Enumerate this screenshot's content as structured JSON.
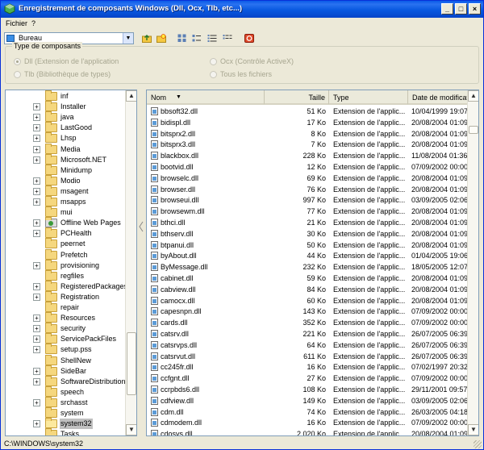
{
  "window": {
    "title": "Enregistrement de composants Windows (Dll, Ocx, Tlb, etc...)",
    "minimize": "_",
    "maximize": "□",
    "close": "×"
  },
  "menu": {
    "items": [
      "Fichier",
      "?"
    ]
  },
  "toolbar": {
    "location": "Bureau",
    "dropdown_glyph": "▼"
  },
  "component_type": {
    "legend": "Type de composants",
    "options": [
      {
        "label": "Dll (Extension de l'application",
        "checked": true
      },
      {
        "label": "Tlb (Bibliothèque de types)",
        "checked": false
      },
      {
        "label": "Ocx (Contrôle ActiveX)",
        "checked": false
      },
      {
        "label": "Tous les fichiers",
        "checked": false
      }
    ]
  },
  "tree": {
    "folders": [
      {
        "label": "inf",
        "expander": ""
      },
      {
        "label": "Installer",
        "expander": "+"
      },
      {
        "label": "java",
        "expander": "+"
      },
      {
        "label": "LastGood",
        "expander": "+"
      },
      {
        "label": "Lhsp",
        "expander": "+"
      },
      {
        "label": "Media",
        "expander": "+"
      },
      {
        "label": "Microsoft.NET",
        "expander": "+"
      },
      {
        "label": "Minidump",
        "expander": ""
      },
      {
        "label": "Modio",
        "expander": "+"
      },
      {
        "label": "msagent",
        "expander": "+"
      },
      {
        "label": "msapps",
        "expander": "+"
      },
      {
        "label": "mui",
        "expander": ""
      },
      {
        "label": "Offline Web Pages",
        "expander": "+",
        "special": true
      },
      {
        "label": "PCHealth",
        "expander": "+"
      },
      {
        "label": "peernet",
        "expander": ""
      },
      {
        "label": "Prefetch",
        "expander": ""
      },
      {
        "label": "provisioning",
        "expander": "+"
      },
      {
        "label": "regfiles",
        "expander": ""
      },
      {
        "label": "RegisteredPackages",
        "expander": "+"
      },
      {
        "label": "Registration",
        "expander": "+"
      },
      {
        "label": "repair",
        "expander": ""
      },
      {
        "label": "Resources",
        "expander": "+"
      },
      {
        "label": "security",
        "expander": "+"
      },
      {
        "label": "ServicePackFiles",
        "expander": "+"
      },
      {
        "label": "setup.pss",
        "expander": "+"
      },
      {
        "label": "ShellNew",
        "expander": ""
      },
      {
        "label": "SideBar",
        "expander": "+"
      },
      {
        "label": "SoftwareDistribution",
        "expander": "+"
      },
      {
        "label": "speech",
        "expander": ""
      },
      {
        "label": "srchasst",
        "expander": "+"
      },
      {
        "label": "system",
        "expander": ""
      },
      {
        "label": "system32",
        "expander": "+",
        "selected": true
      },
      {
        "label": "Tasks",
        "expander": ""
      }
    ]
  },
  "list": {
    "columns": [
      "Nom",
      "Taille",
      "Type",
      "Date de modification"
    ],
    "sort_glyph": "▼",
    "rows": [
      [
        "bbsoft32.dll",
        "51 Ko",
        "Extension de l'applic...",
        "10/04/1999 19:07"
      ],
      [
        "bidispl.dll",
        "17 Ko",
        "Extension de l'applic...",
        "20/08/2004 01:09"
      ],
      [
        "bitsprx2.dll",
        "8 Ko",
        "Extension de l'applic...",
        "20/08/2004 01:09"
      ],
      [
        "bitsprx3.dll",
        "7 Ko",
        "Extension de l'applic...",
        "20/08/2004 01:09"
      ],
      [
        "blackbox.dll",
        "228 Ko",
        "Extension de l'applic...",
        "11/08/2004 01:36"
      ],
      [
        "bootvid.dll",
        "12 Ko",
        "Extension de l'applic...",
        "07/09/2002 00:00"
      ],
      [
        "browselc.dll",
        "69 Ko",
        "Extension de l'applic...",
        "20/08/2004 01:09"
      ],
      [
        "browser.dll",
        "76 Ko",
        "Extension de l'applic...",
        "20/08/2004 01:09"
      ],
      [
        "browseui.dll",
        "997 Ko",
        "Extension de l'applic...",
        "03/09/2005 02:06"
      ],
      [
        "browsewm.dll",
        "77 Ko",
        "Extension de l'applic...",
        "20/08/2004 01:09"
      ],
      [
        "bthci.dll",
        "21 Ko",
        "Extension de l'applic...",
        "20/08/2004 01:09"
      ],
      [
        "bthserv.dll",
        "30 Ko",
        "Extension de l'applic...",
        "20/08/2004 01:09"
      ],
      [
        "btpanui.dll",
        "50 Ko",
        "Extension de l'applic...",
        "20/08/2004 01:09"
      ],
      [
        "byAbout.dll",
        "44 Ko",
        "Extension de l'applic...",
        "01/04/2005 19:06"
      ],
      [
        "ByMessage.dll",
        "232 Ko",
        "Extension de l'applic...",
        "18/05/2005 12:07"
      ],
      [
        "cabinet.dll",
        "59 Ko",
        "Extension de l'applic...",
        "20/08/2004 01:09"
      ],
      [
        "cabview.dll",
        "84 Ko",
        "Extension de l'applic...",
        "20/08/2004 01:09"
      ],
      [
        "camocx.dll",
        "60 Ko",
        "Extension de l'applic...",
        "20/08/2004 01:09"
      ],
      [
        "capesnpn.dll",
        "143 Ko",
        "Extension de l'applic...",
        "07/09/2002 00:00"
      ],
      [
        "cards.dll",
        "352 Ko",
        "Extension de l'applic...",
        "07/09/2002 00:00"
      ],
      [
        "catsrv.dll",
        "221 Ko",
        "Extension de l'applic...",
        "26/07/2005 06:39"
      ],
      [
        "catsrvps.dll",
        "64 Ko",
        "Extension de l'applic...",
        "26/07/2005 06:39"
      ],
      [
        "catsrvut.dll",
        "611 Ko",
        "Extension de l'applic...",
        "26/07/2005 06:39"
      ],
      [
        "cc245fr.dll",
        "16 Ko",
        "Extension de l'applic...",
        "07/02/1997 20:32"
      ],
      [
        "ccfgnt.dll",
        "27 Ko",
        "Extension de l'applic...",
        "07/09/2002 00:00"
      ],
      [
        "ccrpbds6.dll",
        "108 Ko",
        "Extension de l'applic...",
        "29/11/2001 09:57"
      ],
      [
        "cdfview.dll",
        "149 Ko",
        "Extension de l'applic...",
        "03/09/2005 02:06"
      ],
      [
        "cdm.dll",
        "74 Ko",
        "Extension de l'applic...",
        "26/03/2005 04:18"
      ],
      [
        "cdmodem.dll",
        "16 Ko",
        "Extension de l'applic...",
        "07/09/2002 00:00"
      ],
      [
        "cdosys.dll",
        "2 020 Ko",
        "Extension de l'applic...",
        "20/08/2004 01:09"
      ]
    ]
  },
  "status": {
    "path": "C:\\WINDOWS\\system32"
  }
}
